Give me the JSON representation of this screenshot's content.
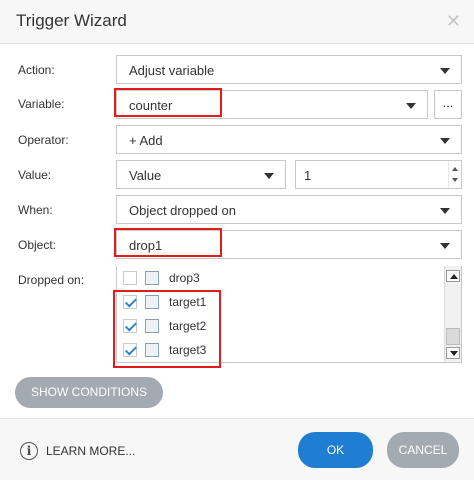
{
  "dialog": {
    "title": "Trigger Wizard",
    "close_icon": "close-icon"
  },
  "form": {
    "action": {
      "label": "Action:",
      "value": "Adjust variable"
    },
    "variable": {
      "label": "Variable:",
      "value": "counter",
      "browse_label": "..."
    },
    "operator": {
      "label": "Operator:",
      "value": "+ Add"
    },
    "value": {
      "label": "Value:",
      "type": "Value",
      "number": "1"
    },
    "when": {
      "label": "When:",
      "value": "Object dropped on"
    },
    "object": {
      "label": "Object:",
      "value": "drop1"
    },
    "dropped_on": {
      "label": "Dropped on:",
      "items": [
        {
          "label": "drop3",
          "checked": false
        },
        {
          "label": "target1",
          "checked": true
        },
        {
          "label": "target2",
          "checked": true
        },
        {
          "label": "target3",
          "checked": true
        }
      ]
    }
  },
  "buttons": {
    "show_conditions": "SHOW CONDITIONS",
    "learn_more": "LEARN MORE...",
    "ok": "OK",
    "cancel": "CANCEL"
  },
  "colors": {
    "primary": "#1f7ed2",
    "secondary": "#a3aab1",
    "highlight": "#e21b1b",
    "check": "#2d83c9"
  }
}
